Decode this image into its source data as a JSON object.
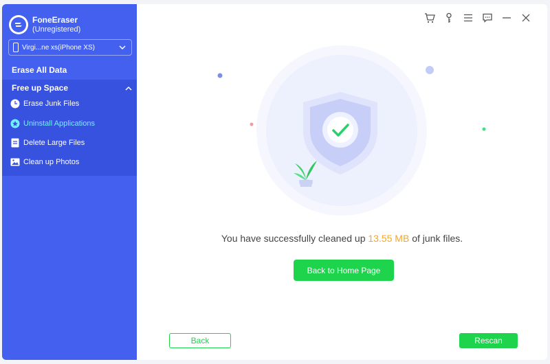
{
  "app": {
    "name": "FoneEraser",
    "status": "(Unregistered)"
  },
  "device": {
    "selected": "Virgi...ne xs(iPhone XS)"
  },
  "sidebar": {
    "erase_all": "Erase All Data",
    "group_title": "Free up Space",
    "items": [
      {
        "label": "Erase Junk Files",
        "icon": "clock-icon",
        "active": false
      },
      {
        "label": "Uninstall Applications",
        "icon": "apps-star-icon",
        "active": true
      },
      {
        "label": "Delete Large Files",
        "icon": "file-icon",
        "active": false
      },
      {
        "label": "Clean up Photos",
        "icon": "photo-icon",
        "active": false
      }
    ]
  },
  "titlebar": {
    "icons": [
      "cart-icon",
      "key-icon",
      "menu-icon",
      "feedback-icon",
      "minimize-icon",
      "close-icon"
    ]
  },
  "result": {
    "prefix": "You have successfully cleaned up",
    "size": "13.55 MB",
    "suffix": "of junk files."
  },
  "buttons": {
    "home": "Back to Home Page",
    "back": "Back",
    "rescan": "Rescan"
  },
  "colors": {
    "sidebar": "#4361ee",
    "accent_green": "#1dd44c",
    "size_highlight": "#f5a524",
    "active_item": "#74f1ff"
  }
}
